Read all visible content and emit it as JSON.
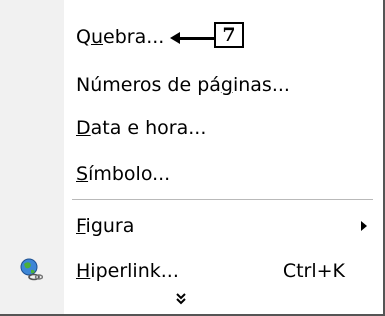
{
  "menu": {
    "items": [
      {
        "pre": "Q",
        "u": "u",
        "post": "ebra..."
      },
      {
        "pre": "Números de pá",
        "u": "g",
        "post": "inas..."
      },
      {
        "pre": "",
        "u": "D",
        "post": "ata e hora..."
      },
      {
        "pre": "",
        "u": "S",
        "post": "ímbolo..."
      },
      {
        "pre": "",
        "u": "F",
        "post": "igura"
      },
      {
        "pre": "",
        "u": "H",
        "post": "iperlink..."
      }
    ],
    "hyperlink_shortcut": "Ctrl+K",
    "icons": {
      "hyperlink": "globe-link-icon",
      "figura_submenu": "submenu-arrow-icon",
      "expand": "double-chevron-down-icon"
    }
  },
  "callout": {
    "number": "7"
  }
}
